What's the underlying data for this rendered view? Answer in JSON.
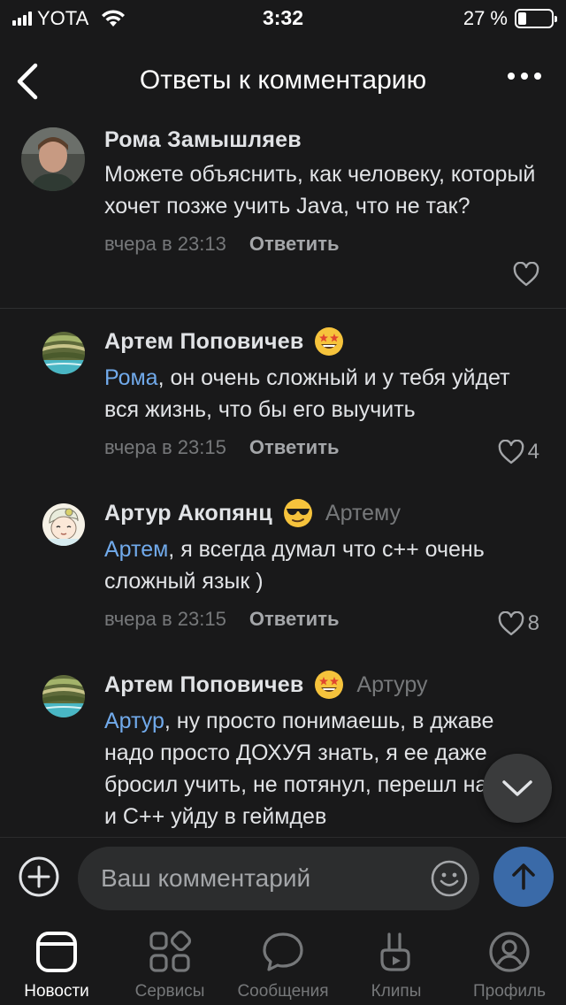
{
  "status_bar": {
    "carrier": "YOTA",
    "time": "3:32",
    "battery": "27 %",
    "battery_level": 0.27
  },
  "header": {
    "title": "Ответы к комментарию"
  },
  "comments": [
    {
      "author": "Рома Замышляев",
      "text": "Можете объяснить, как человеку, который хочет позже учить Java, что не так?",
      "date": "вчера в 23:13",
      "reply_label": "Ответить",
      "likes": ""
    },
    {
      "author": "Артем Поповичев",
      "emoji": "star-struck-emoji",
      "mention": "Рома",
      "text": ", он очень сложный и у тебя уйдет вся жизнь, что бы его выучить",
      "date": "вчера в 23:15",
      "reply_label": "Ответить",
      "likes": "4"
    },
    {
      "author": "Артур Акопянц",
      "emoji": "sunglasses-emoji",
      "reply_to": "Артему",
      "mention": "Артем",
      "text": ", я всегда думал что с++ очень сложный язык )",
      "date": "вчера в 23:15",
      "reply_label": "Ответить",
      "likes": "8"
    },
    {
      "author": "Артем Поповичев",
      "emoji": "star-struck-emoji",
      "reply_to": "Артуру",
      "mention": "Артур",
      "text": ", ну просто понимаешь, в джаве надо просто ДОХУЯ знать, я ее даже бросил учить, не потянул, перешл на С# и С++ уйду в геймдев"
    }
  ],
  "composer": {
    "placeholder": "Ваш комментарий"
  },
  "tabbar": [
    {
      "label": "Новости",
      "icon": "news-icon",
      "active": true
    },
    {
      "label": "Сервисы",
      "icon": "services-icon"
    },
    {
      "label": "Сообщения",
      "icon": "messages-icon"
    },
    {
      "label": "Клипы",
      "icon": "clips-icon"
    },
    {
      "label": "Профиль",
      "icon": "profile-icon"
    }
  ],
  "colors": {
    "background": "#19191a",
    "accent": "#71aaeb",
    "send_button": "#3a6aa8",
    "secondary_text": "#76787a"
  }
}
